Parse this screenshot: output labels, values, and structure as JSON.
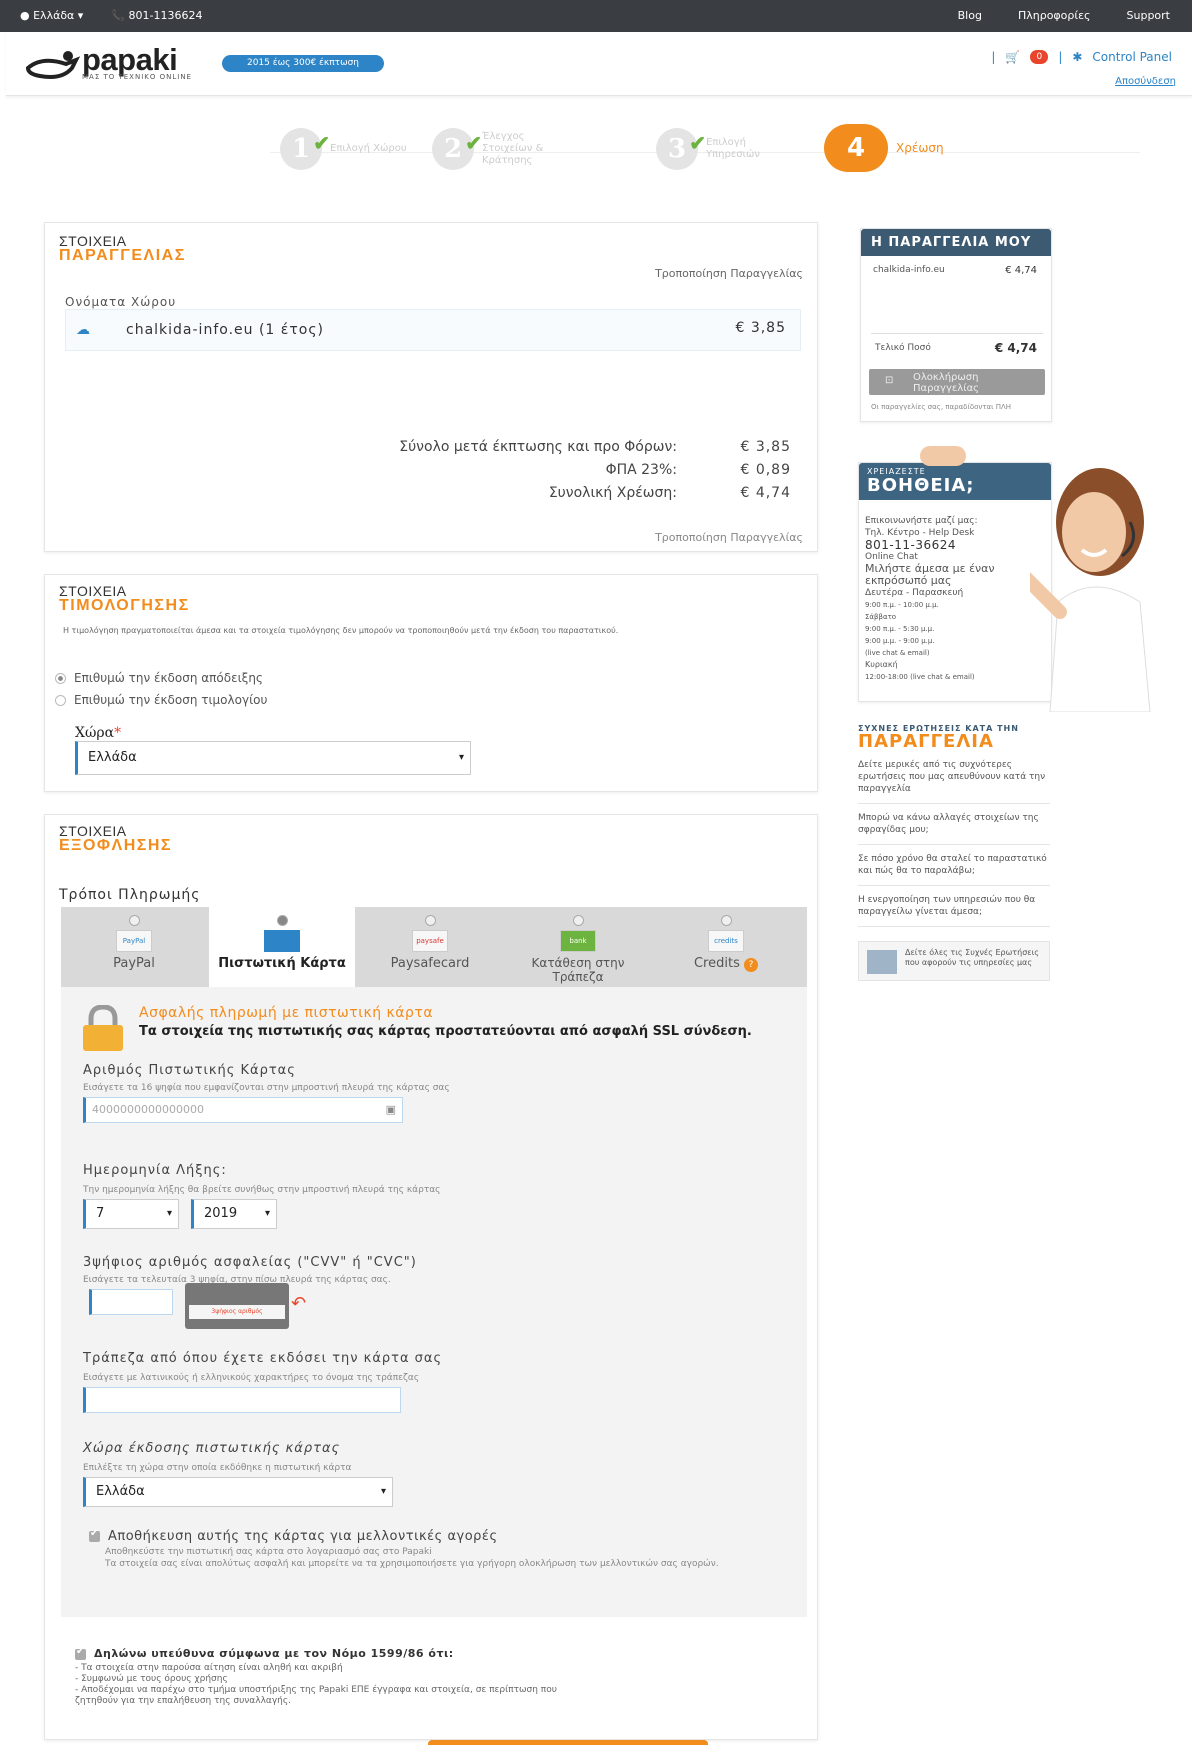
{
  "topbar": {
    "location": "Ελλάδα",
    "phone": "801-1136624",
    "links": [
      "Blog",
      "Πληροφορίες",
      "Support"
    ]
  },
  "header": {
    "logo_text": "papaki",
    "logo_sub": "ΜΑΣ ΤΟ ΤΕΧΝΙΚΟ ΟΝLINE",
    "promo": "2015 έως 300€ έκπτωση",
    "cart_count": "0",
    "control_panel": "Control Panel",
    "signout": "Αποσύνδεση"
  },
  "steps": [
    {
      "num": "1",
      "label": "Επιλογή Χώρου"
    },
    {
      "num": "2",
      "label": "Έλεγχος Στοιχείων & Κράτησης"
    },
    {
      "num": "3",
      "label": "Επιλογή Υπηρεσιών"
    },
    {
      "num": "4",
      "label": "Χρέωση"
    }
  ],
  "order": {
    "title1": "ΣΤΟΙΧΕΙΑ",
    "title2": "ΠΑΡΑΓΓΕΛΙΑΣ",
    "modify": "Τροποποίηση Παραγγελίας",
    "domains_label": "Ονόματα Χώρου",
    "domain": "chalkida-info.eu (1 έτος)",
    "domain_price": "€ 3,85",
    "totals": [
      {
        "label": "Σύνολο μετά έκπτωσης και προ Φόρων:",
        "value": "€ 3,85"
      },
      {
        "label": "ΦΠΑ 23%:",
        "value": "€ 0,89"
      },
      {
        "label": "Συνολική Χρέωση:",
        "value": "€ 4,74"
      }
    ],
    "modify_bottom": "Τροποποίηση Παραγγελίας"
  },
  "billing": {
    "title1": "ΣΤΟΙΧΕΙΑ",
    "title2": "ΤΙΜΟΛΟΓΗΣΗΣ",
    "note": "Η τιμολόγηση πραγματοποιείται άμεσα και τα στοιχεία τιμολόγησης δεν μπορούν να τροποποιηθούν μετά την έκδοση του παραστατικού.",
    "opt_receipt": "Επιθυμώ την έκδοση απόδειξης",
    "opt_invoice": "Επιθυμώ την έκδοση τιμολογίου",
    "country_label": "Χώρα",
    "required": "*",
    "country_value": "Ελλάδα"
  },
  "payment": {
    "title1": "ΣΤΟΙΧΕΙΑ",
    "title2": "ΕΞΟΦΛΗΣΗΣ",
    "methods_label": "Τρόποι Πληρωμής",
    "tabs": [
      {
        "label": "PayPal",
        "icon": "PayPal"
      },
      {
        "label": "Πιστωτική Κάρτα",
        "icon": "card"
      },
      {
        "label": "Paysafecard",
        "icon": "paysafe"
      },
      {
        "label": "Κατάθεση στην Τράπεζα",
        "icon": "bank"
      },
      {
        "label": "Credits",
        "icon": "credits"
      }
    ],
    "secure_title": "Ασφαλής πληρωμή με πιστωτική κάρτα",
    "secure_text": "Τα στοιχεία της πιστωτικής σας κάρτας προστατεύονται από ασφαλή SSL σύνδεση.",
    "card_number_label": "Αριθμός Πιστωτικής Κάρτας",
    "card_number_hint": "Εισάγετε τα 16 ψηφία που εμφανίζονται στην μπροστινή πλευρά της κάρτας σας",
    "card_number_value": "4000000000000000",
    "expiry_label": "Ημερομηνία Λήξης:",
    "expiry_hint": "Την ημερομηνία λήξης θα βρείτε συνήθως στην μπροστινή πλευρά της κάρτας",
    "expiry_month": "7",
    "expiry_year": "2019",
    "cvv_label": "3ψήφιος αριθμός ασφαλείας (\"CVV\" ή \"CVC\")",
    "cvv_hint": "Εισάγετε τα τελευταία 3 ψηφία, στην πίσω πλευρά της κάρτας σας.",
    "cvv_card_text": "3ψήφιος αριθμός",
    "bank_label": "Τράπεζα από όπου έχετε εκδόσει την κάρτα σας",
    "bank_hint": "Εισάγετε με λατινικούς ή ελληνικούς χαρακτήρες το όνομα της τράπεζας",
    "issuing_country_label": "Χώρα έκδοσης πιστωτικής κάρτας",
    "issuing_country_hint": "Επιλέξτε τη χώρα στην οποία εκδόθηκε η πιστωτική κάρτα",
    "issuing_country_value": "Ελλάδα",
    "save_card_label": "Αποθήκευση αυτής της κάρτας για μελλοντικές αγορές",
    "save_card_hint1": "Αποθηκεύστε την πιστωτική σας κάρτα στο λογαριασμό σας στο Papaki",
    "save_card_hint2": "Τα στοιχεία σας είναι απολύτως ασφαλή και μπορείτε να τα χρησιμοποιήσετε για γρήγορη ολοκλήρωση των μελλοντικών σας αγορών.",
    "declare_label": "Δηλώνω υπεύθυνα σύμφωνα με τον Νόμο 1599/86 ότι:",
    "declare_lines": [
      "- Τα στοιχεία στην παρούσα αίτηση είναι αληθή και ακριβή",
      "- Συμφωνώ με τους όρους χρήσης",
      "- Αποδέχομαι να παρέχω στο τμήμα υποστήριξης της Papaki ΕΠΕ έγγραφα και στοιχεία, σε περίπτωση που",
      "  ζητηθούν για την επαλήθευση της συναλλαγής."
    ]
  },
  "sidebar": {
    "my_order_title": "Η ΠΑΡΑΓΓΕΛΙΑ ΜΟΥ",
    "item": "chalkida-info.eu",
    "item_price": "€ 4,74",
    "final_label": "Τελικό Ποσό",
    "final_value": "€ 4,74",
    "complete_btn": "Ολοκλήρωση Παραγγελίας",
    "terms_note": "Οι παραγγελίες σας, παραδίδονται ΠΛΗ",
    "help_small": "ΧΡΕΙΑΖΕΣΤΕ",
    "help_big": "ΒΟΗΘΕΙΑ;",
    "help_lines": [
      "Επικοινωνήστε μαζί μας:",
      "Τηλ. Κέντρο - Help Desk",
      "801-11-36624",
      "Online Chat",
      "Μιλήστε άμεσα με έναν",
      "εκπρόσωπό μας",
      "Δευτέρα - Παρασκευή",
      "9:00 π.μ. - 10:00 μ.μ.",
      "Σάββατο",
      "9:00 π.μ. - 5:30 μ.μ.",
      "9:00 μ.μ. - 9:00 μ.μ.",
      "(live chat & email)",
      "Κυριακή",
      "12:00-18:00 (live chat & email)"
    ],
    "faq_title1": "ΣΥΧΝΕΣ ΕΡΩΤΗΣΕΙΣ ΚΑΤΑ ΤΗΝ",
    "faq_title2": "ΠΑΡΑΓΓΕΛΙΑ",
    "faq_items": [
      "Δείτε μερικές από τις συχνότερες ερωτήσεις που μας απευθύνουν κατά την παραγγελία",
      "Μπορώ να κάνω αλλαγές στοιχείων της σφραγίδας μου;",
      "Σε πόσο χρόνο θα σταλεί το παραστατικό και πώς θα το παραλάβω;",
      "Η ενεργοποίηση των υπηρεσιών που θα παραγγείλω γίνεται άμεσα;"
    ],
    "faq_all": "Δείτε όλες τις Συχνές Ερωτήσεις που αφορούν τις υπηρεσίες μας"
  }
}
